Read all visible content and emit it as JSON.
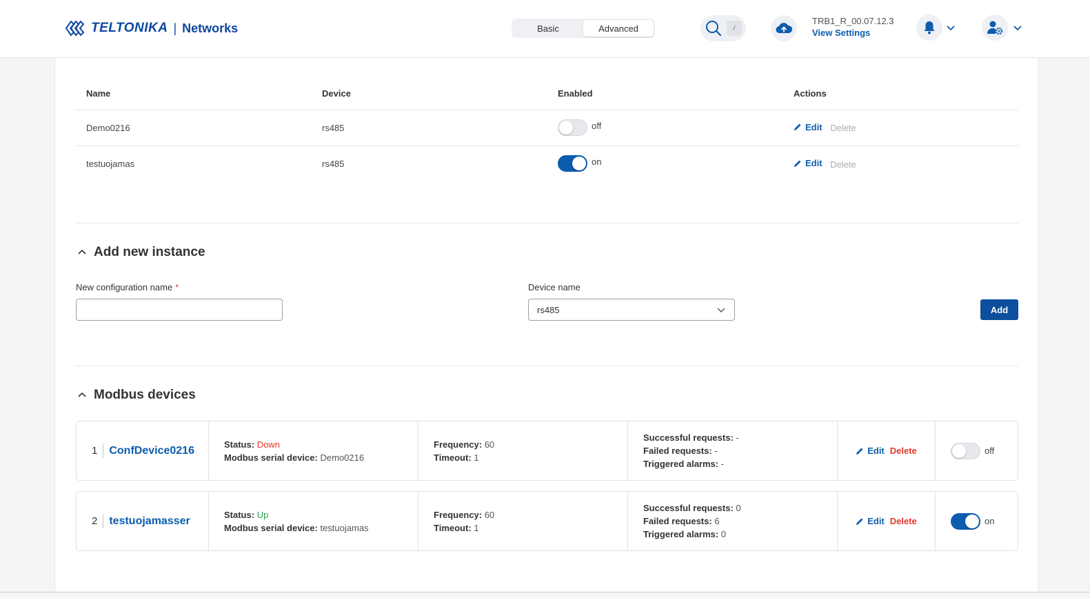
{
  "header": {
    "brand": "TELTONIKA",
    "separator": "|",
    "product": "Networks",
    "modes": [
      "Basic",
      "Advanced"
    ],
    "active_mode": "Advanced",
    "search_shortcut": "/",
    "firmware": "TRB1_R_00.07.12.3",
    "view_settings": "View Settings"
  },
  "instances_table": {
    "columns": [
      "Name",
      "Device",
      "Enabled",
      "Actions"
    ],
    "rows": [
      {
        "name": "Demo0216",
        "device": "rs485",
        "enabled": "off",
        "edit": "Edit",
        "delete": "Delete"
      },
      {
        "name": "testuojamas",
        "device": "rs485",
        "enabled": "on",
        "edit": "Edit",
        "delete": "Delete"
      }
    ]
  },
  "add_instance": {
    "title": "Add new instance",
    "config_name_label": "New configuration name",
    "required_mark": "*",
    "config_name_value": "",
    "device_name_label": "Device name",
    "device_name_value": "rs485",
    "add_label": "Add"
  },
  "modbus_devices": {
    "title": "Modbus devices",
    "labels": {
      "status": "Status:",
      "serial_device": "Modbus serial device:",
      "frequency": "Frequency:",
      "timeout": "Timeout:",
      "successful": "Successful requests:",
      "failed": "Failed requests:",
      "alarms": "Triggered alarms:",
      "edit": "Edit",
      "delete": "Delete"
    },
    "devices": [
      {
        "index": "1",
        "name": "ConfDevice0216",
        "status": "Down",
        "serial_device": "Demo0216",
        "frequency": "60",
        "timeout": "1",
        "successful": "-",
        "failed": "-",
        "alarms": "-",
        "enabled": "off"
      },
      {
        "index": "2",
        "name": "testuojamasser",
        "status": "Up",
        "serial_device": "testuojamas",
        "frequency": "60",
        "timeout": "1",
        "successful": "0",
        "failed": "6",
        "alarms": "0",
        "enabled": "on"
      }
    ]
  },
  "colors": {
    "accent": "#0d5cae",
    "danger": "#e0392b",
    "success": "#2e9e4a"
  }
}
